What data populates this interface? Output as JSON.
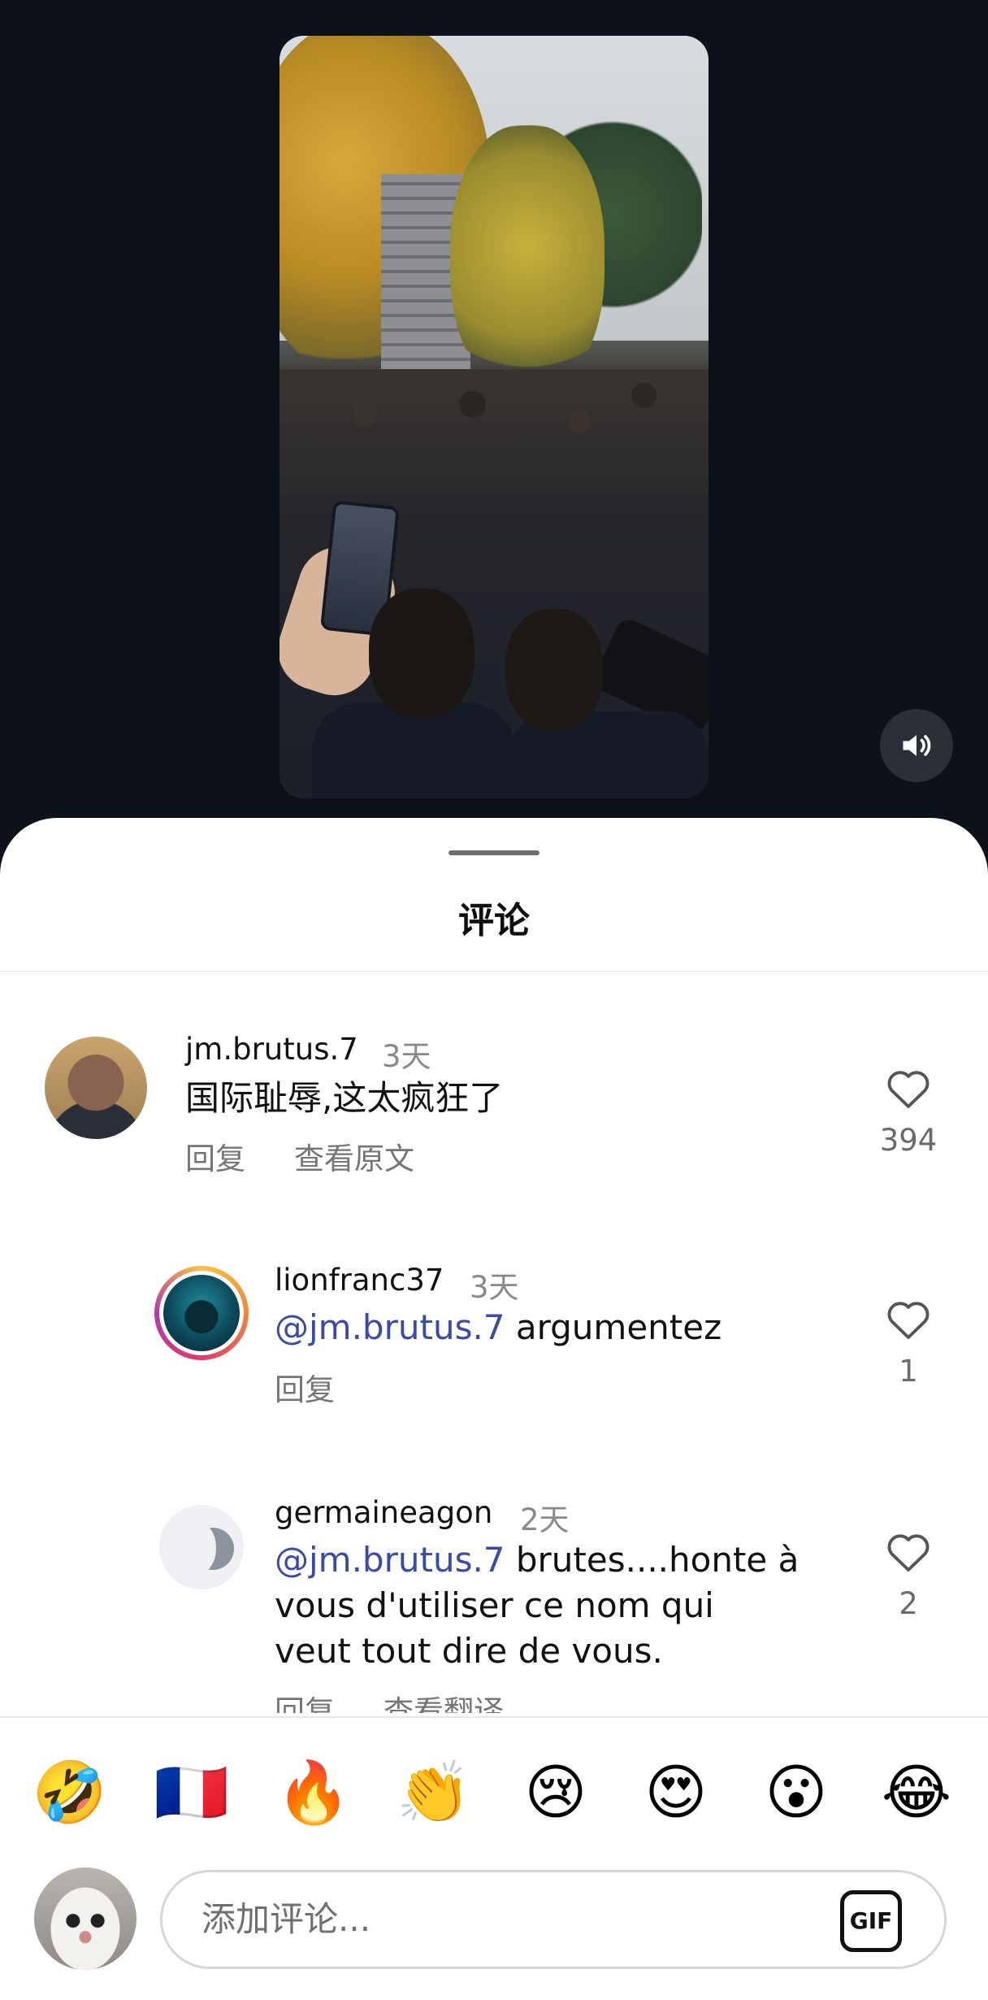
{
  "sheet": {
    "title": "评论"
  },
  "comments": [
    {
      "username": "jm.brutus.7",
      "time": "3天",
      "text": "国际耻辱,这太疯狂了",
      "actions": [
        "回复",
        "查看原文"
      ],
      "likes": "394"
    },
    {
      "username": "lionfranc37",
      "time": "3天",
      "mention": "@jm.brutus.7",
      "text": " argumentez",
      "actions": [
        "回复"
      ],
      "likes": "1"
    },
    {
      "username": "germaineagon",
      "time": "2天",
      "mention": "@jm.brutus.7",
      "text_line1": " brutes....honte à",
      "text_line2": "vous d'utiliser ce nom qui",
      "text_line3": "veut tout dire de vous.",
      "actions": [
        "回复",
        "查看翻译"
      ],
      "likes": "2"
    }
  ],
  "emojis": [
    "🤣",
    "🇫🇷",
    "🔥",
    "👏",
    "😢",
    "😍",
    "😮",
    "😂"
  ],
  "input": {
    "placeholder": "添加评论...",
    "gif_label": "GIF"
  },
  "icons": {
    "volume": "volume-icon",
    "heart": "heart-icon"
  }
}
